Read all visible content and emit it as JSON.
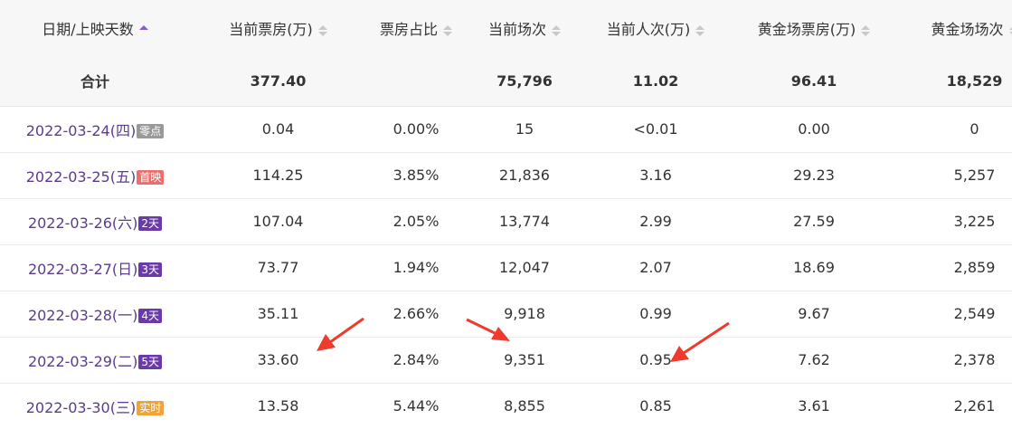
{
  "table": {
    "headers": [
      "日期/上映天数",
      "当前票房(万)",
      "票房占比",
      "当前场次",
      "当前人次(万)",
      "黄金场票房(万)",
      "黄金场场次"
    ],
    "total": [
      "合计",
      "377.40",
      "",
      "75,796",
      "11.02",
      "96.41",
      "18,529"
    ],
    "rows": [
      {
        "date": "2022-03-24(四)",
        "badge": "零点",
        "badge_color": "#999999",
        "values": [
          "0.04",
          "0.00%",
          "15",
          "<0.01",
          "0.00",
          "0"
        ]
      },
      {
        "date": "2022-03-25(五)",
        "badge": "首映",
        "badge_color": "#ee6e6e",
        "values": [
          "114.25",
          "3.85%",
          "21,836",
          "3.16",
          "29.23",
          "5,257"
        ]
      },
      {
        "date": "2022-03-26(六)",
        "badge": "2天",
        "badge_color": "#6a3aa8",
        "values": [
          "107.04",
          "2.05%",
          "13,774",
          "2.99",
          "27.59",
          "3,225"
        ]
      },
      {
        "date": "2022-03-27(日)",
        "badge": "3天",
        "badge_color": "#6a3aa8",
        "values": [
          "73.77",
          "1.94%",
          "12,047",
          "2.07",
          "18.69",
          "2,859"
        ]
      },
      {
        "date": "2022-03-28(一)",
        "badge": "4天",
        "badge_color": "#6a3aa8",
        "values": [
          "35.11",
          "2.66%",
          "9,918",
          "0.99",
          "9.67",
          "2,549"
        ]
      },
      {
        "date": "2022-03-29(二)",
        "badge": "5天",
        "badge_color": "#6a3aa8",
        "values": [
          "33.60",
          "2.84%",
          "9,351",
          "0.95",
          "7.62",
          "2,378"
        ]
      },
      {
        "date": "2022-03-30(三)",
        "badge": "实时",
        "badge_color": "#f0a33a",
        "values": [
          "13.58",
          "5.44%",
          "8,855",
          "0.85",
          "3.61",
          "2,261"
        ]
      }
    ]
  },
  "colors": {
    "accent": "#5b3a8f",
    "arrow": "#ee3b2e",
    "header_bg": "#f7f7f8"
  }
}
